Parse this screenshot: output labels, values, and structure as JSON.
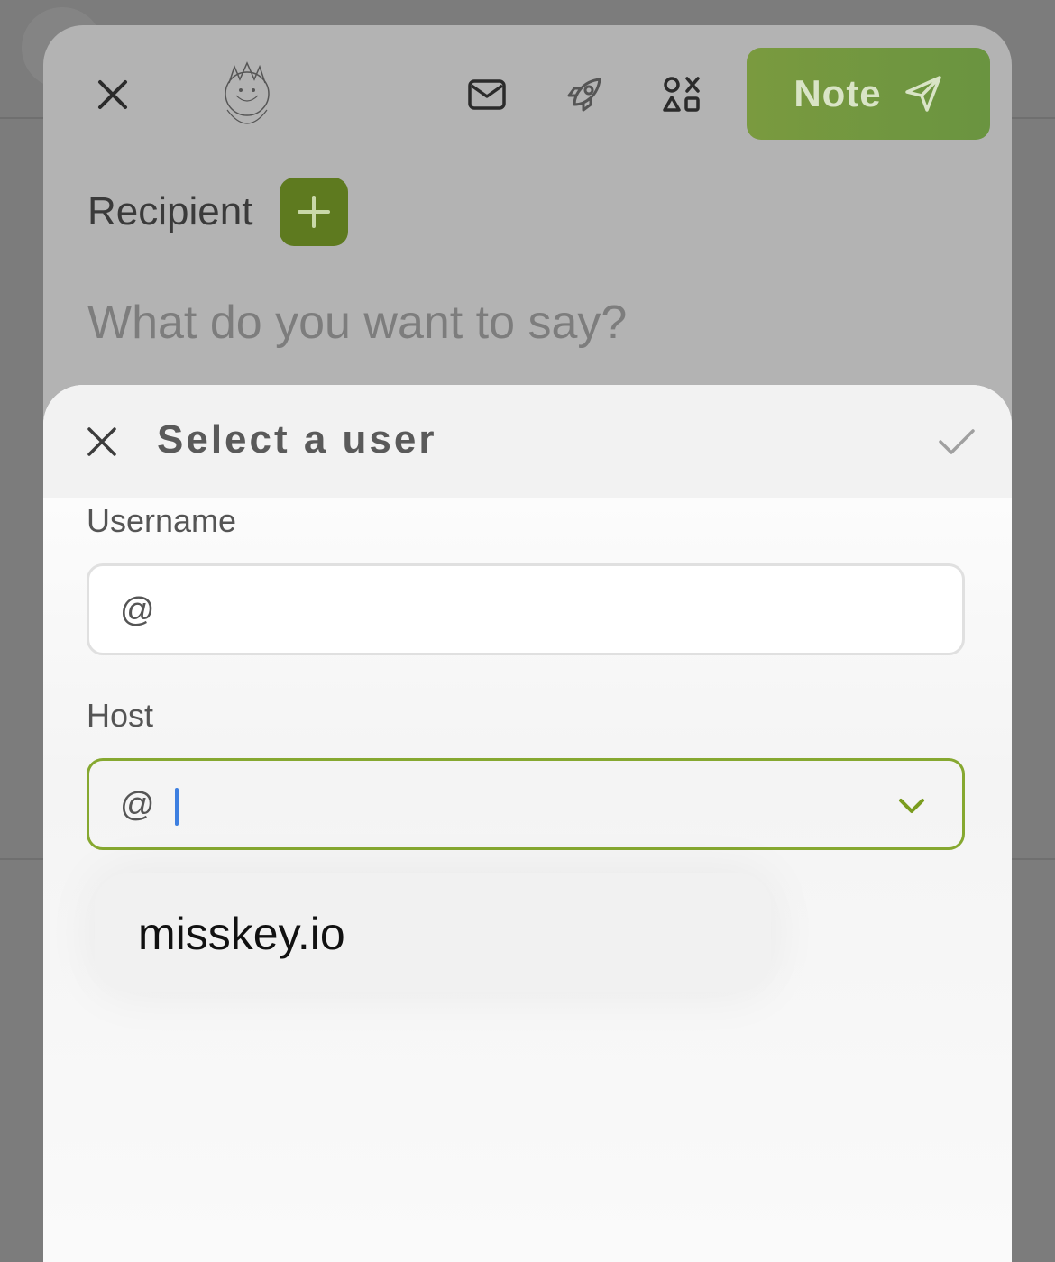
{
  "composer": {
    "note_button_label": "Note",
    "recipient_label": "Recipient",
    "text_placeholder": "What do you want to say?",
    "icons": [
      "close-icon",
      "mail-icon",
      "rocket-icon",
      "shapes-icon",
      "send-icon",
      "plus-icon"
    ]
  },
  "dialog": {
    "title": "Select a user",
    "username_label": "Username",
    "username_prefix": "@",
    "username_value": "",
    "host_label": "Host",
    "host_prefix": "@",
    "host_value": "",
    "suggestions": [
      "misskey.io"
    ]
  },
  "colors": {
    "accent": "#86a830",
    "note_button": "#6f9640",
    "recipient_add": "#5e7a1f",
    "caret": "#3d7fe0"
  }
}
